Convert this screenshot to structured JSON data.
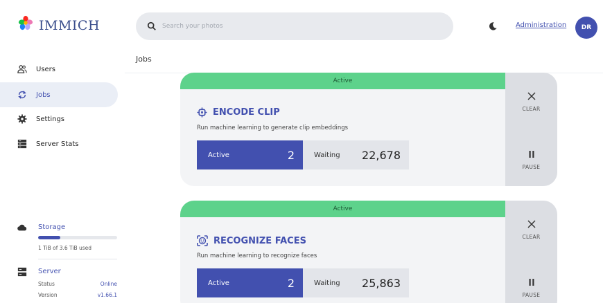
{
  "header": {
    "logo_text": "IMMICH",
    "search_placeholder": "Search your photos",
    "admin_link": "Administration",
    "avatar_initials": "DR"
  },
  "sidebar": {
    "items": [
      {
        "label": "Users",
        "icon": "users-icon",
        "active": false
      },
      {
        "label": "Jobs",
        "icon": "sync-icon",
        "active": true
      },
      {
        "label": "Settings",
        "icon": "gear-icon",
        "active": false
      },
      {
        "label": "Server Stats",
        "icon": "server-icon",
        "active": false
      }
    ],
    "storage": {
      "title": "Storage",
      "usage_text": "1 TiB of 3.6 TiB used",
      "used_fraction": 0.28
    },
    "server": {
      "title": "Server",
      "status_label": "Status",
      "status_value": "Online",
      "version_label": "Version",
      "version_value": "v1.66.1"
    }
  },
  "main": {
    "page_title": "Jobs",
    "jobs": [
      {
        "status": "Active",
        "title": "ENCODE CLIP",
        "icon": "chip-icon",
        "description": "Run machine learning to generate clip embeddings",
        "active_label": "Active",
        "active_count": "2",
        "waiting_label": "Waiting",
        "waiting_count": "22,678",
        "clear_label": "CLEAR",
        "pause_label": "PAUSE"
      },
      {
        "status": "Active",
        "title": "RECOGNIZE FACES",
        "icon": "face-recognition-icon",
        "description": "Run machine learning to recognize faces",
        "active_label": "Active",
        "active_count": "2",
        "waiting_label": "Waiting",
        "waiting_count": "25,863",
        "clear_label": "CLEAR",
        "pause_label": "PAUSE"
      }
    ]
  },
  "colors": {
    "accent": "#4250af",
    "status_active": "#5dd28b"
  }
}
